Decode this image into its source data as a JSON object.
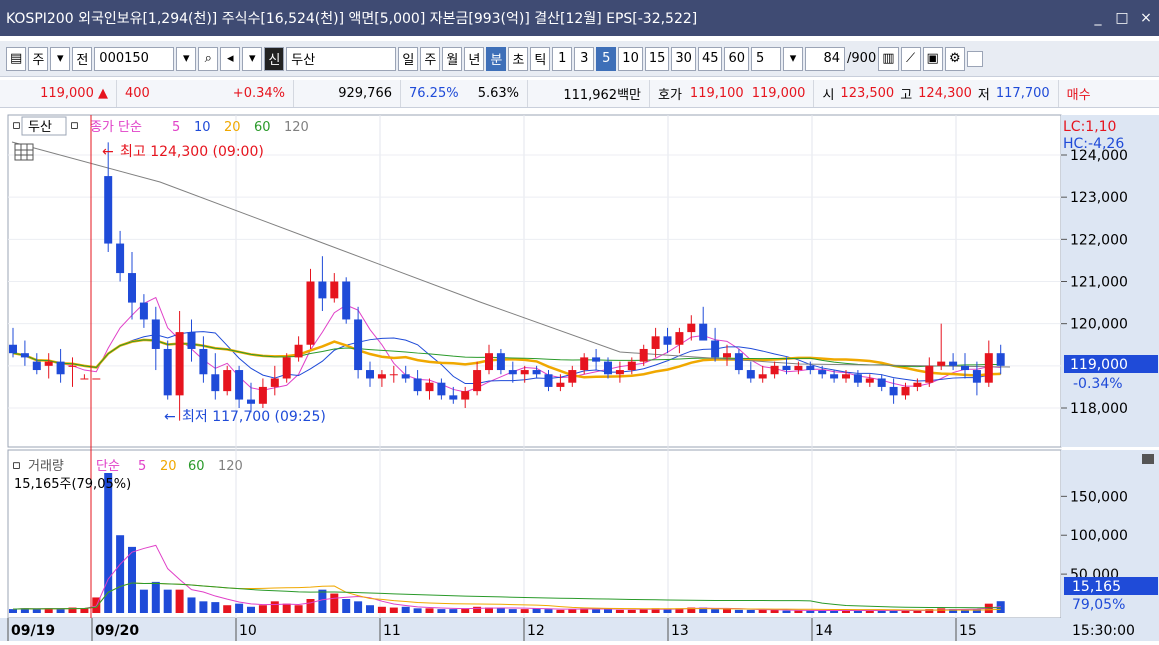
{
  "title": "KOSPI200 외국인보유[1,294(천)] 주식수[16,524(천)] 액면[5,000] 자본금[993(억)] 결산[12월] EPS[-32,522]",
  "window_buttons": {
    "min": "_",
    "max": "□",
    "close": "×"
  },
  "toolbar": {
    "period_jun": "주",
    "period_jeon": "전",
    "code": "000150",
    "sin": "신",
    "name": "두산",
    "periods": [
      "일",
      "주",
      "월",
      "년",
      "분",
      "초",
      "틱"
    ],
    "active_period": "분",
    "intervals": [
      "1",
      "3",
      "5",
      "10",
      "15",
      "30",
      "45",
      "60"
    ],
    "active_interval": "5",
    "interval_select": "5",
    "count": "84",
    "count_total": "/900"
  },
  "infobar": {
    "price": "119,000",
    "price_arrow": "▲",
    "change": "400",
    "change_pct": "+0.34%",
    "volume": "929,766",
    "vol_ratio": "76.25%",
    "turnover": "5.63%",
    "amount": "111,962백만",
    "quote_label": "호가",
    "ask": "119,100",
    "bid": "119,000",
    "open_label": "시",
    "open": "123,500",
    "high_label": "고",
    "high": "124,300",
    "low_label": "저",
    "low": "117,700",
    "buy_label": "매수"
  },
  "price_panel": {
    "stock": "두산",
    "legend_title": "종가 단순",
    "legend_ma": [
      "5",
      "10",
      "20",
      "60",
      "120"
    ],
    "lc": "LC:1,10",
    "hc": "HC:-4,26",
    "high_note": "최고 124,300 (09:00)",
    "low_note": "최저 117,700 (09:25)",
    "y_ticks": [
      "124,000",
      "123,000",
      "122,000",
      "121,000",
      "120,000",
      "118,000"
    ],
    "current_price": "119,000",
    "current_change": "-0.34%"
  },
  "volume_panel": {
    "legend_title": "거래량",
    "legend_sub": "단순",
    "legend_ma": [
      "5",
      "20",
      "60",
      "120"
    ],
    "vol_info": "15,165주(79,05%)",
    "y_ticks": [
      "150,000",
      "100,000",
      "50,000"
    ],
    "current_vol": "15,165",
    "current_pct": "79,05%"
  },
  "x_axis": {
    "labels": [
      "09/19",
      "09/20",
      "10",
      "11",
      "12",
      "13",
      "14",
      "15"
    ],
    "time": "15:30:00"
  },
  "colors": {
    "up": "#e6141e",
    "down": "#1f4bd8",
    "ma5": "#e040c8",
    "ma10": "#1f4bd8",
    "ma20": "#f0a800",
    "ma60": "#2a9a2a",
    "ma120": "#808080"
  }
}
